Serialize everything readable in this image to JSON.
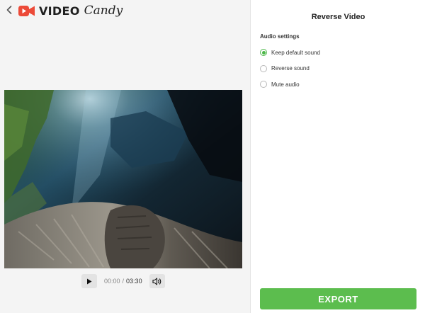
{
  "header": {
    "back_icon": "chevron-left-icon",
    "logo": {
      "icon": "video-camera-icon",
      "word1": "VIDEO",
      "word2": "Candy",
      "brand_color": "#ec4a38"
    }
  },
  "player": {
    "current_time": "00:00",
    "separator": "/",
    "total_time": "03:30",
    "play_icon": "play-icon",
    "volume_icon": "volume-icon"
  },
  "panel": {
    "title": "Reverse Video",
    "section_label": "Audio settings",
    "options": [
      {
        "label": "Keep default sound",
        "checked": true
      },
      {
        "label": "Reverse sound",
        "checked": false
      },
      {
        "label": "Mute audio",
        "checked": false
      }
    ],
    "accent_color": "#4cb748",
    "export_label": "EXPORT",
    "export_color": "#5cbd4e"
  }
}
